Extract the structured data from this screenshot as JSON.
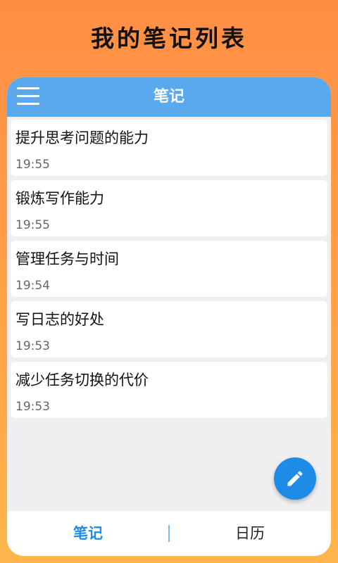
{
  "promo": {
    "title": "我的笔记列表"
  },
  "appbar": {
    "title": "笔记",
    "menu_icon": "hamburger-menu-icon"
  },
  "notes": [
    {
      "title": "提升思考问题的能力",
      "time": "19:55"
    },
    {
      "title": "锻炼写作能力",
      "time": "19:55"
    },
    {
      "title": "管理任务与时间",
      "time": "19:54"
    },
    {
      "title": "写日志的好处",
      "time": "19:53"
    },
    {
      "title": "减少任务切换的代价",
      "time": "19:53"
    }
  ],
  "fab": {
    "icon": "pencil-icon"
  },
  "tabs": [
    {
      "label": "笔记",
      "active": true
    },
    {
      "label": "日历",
      "active": false
    }
  ],
  "colors": {
    "appbar": "#5AA9EE",
    "accent": "#1E8BE6",
    "background_top": "#FF8E45",
    "background_bottom": "#FFB54C"
  }
}
